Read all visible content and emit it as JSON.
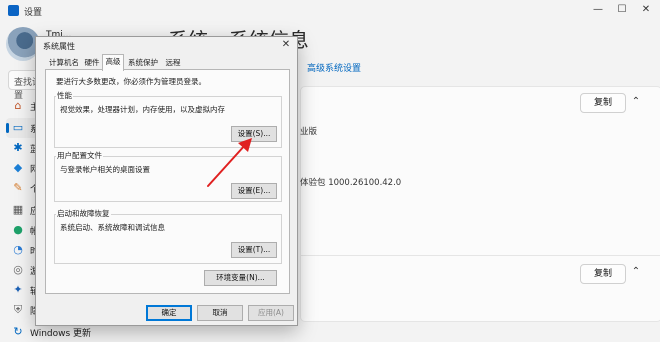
{
  "settings": {
    "window_title": "设置",
    "user_name": "Tmi...",
    "page_heading": "系统 › 系统信息",
    "search_placeholder": "查找设置",
    "sidebar": [
      {
        "icon": "home-icon",
        "glyph": "⌂",
        "label": "主页",
        "color": "#c0562a"
      },
      {
        "icon": "system-icon",
        "glyph": "▭",
        "label": "系统",
        "color": "#0067c0",
        "active": true
      },
      {
        "icon": "bluetooth-icon",
        "glyph": "✱",
        "label": "蓝牙",
        "color": "#0067c0"
      },
      {
        "icon": "network-icon",
        "glyph": "◆",
        "label": "网络",
        "color": "#1c7fd6"
      },
      {
        "icon": "personalization-icon",
        "glyph": "✎",
        "label": "个性",
        "color": "#d47a2a"
      },
      {
        "icon": "apps-icon",
        "glyph": "▦",
        "label": "应用",
        "color": "#555"
      },
      {
        "icon": "accounts-icon",
        "glyph": "●",
        "label": "帐户",
        "color": "#1ea16a"
      },
      {
        "icon": "time-language-icon",
        "glyph": "◔",
        "label": "时间",
        "color": "#2a7bd4"
      },
      {
        "icon": "gaming-icon",
        "glyph": "◎",
        "label": "游戏",
        "color": "#666"
      },
      {
        "icon": "accessibility-icon",
        "glyph": "✦",
        "label": "辅助",
        "color": "#1a5fb4"
      },
      {
        "icon": "privacy-icon",
        "glyph": "⛨",
        "label": "隐私",
        "color": "#666"
      },
      {
        "icon": "windows-update-icon",
        "glyph": "↻",
        "label": "Windows 更新",
        "color": "#0067c0"
      }
    ],
    "advanced_link": "高级系统设置",
    "copy_label": "复制",
    "bg_text_1": "业版",
    "bg_text_2": "体验包 1000.26100.42.0"
  },
  "dialog": {
    "title": "系统属性",
    "tabs": [
      "计算机名",
      "硬件",
      "高级",
      "系统保护",
      "远程"
    ],
    "active_tab": 2,
    "admin_note": "要进行大多数更改，你必须作为管理员登录。",
    "performance": {
      "label": "性能",
      "desc": "视觉效果，处理器计划，内存使用，以及虚拟内存",
      "button": "设置(S)..."
    },
    "user_profiles": {
      "label": "用户配置文件",
      "desc": "与登录帐户相关的桌面设置",
      "button": "设置(E)..."
    },
    "startup_recovery": {
      "label": "启动和故障恢复",
      "desc": "系统启动、系统故障和调试信息",
      "button": "设置(T)..."
    },
    "env_button": "环境变量(N)...",
    "ok": "确定",
    "cancel": "取消",
    "apply": "应用(A)"
  },
  "colors": {
    "accent": "#0067c0",
    "arrow": "#e02020"
  }
}
